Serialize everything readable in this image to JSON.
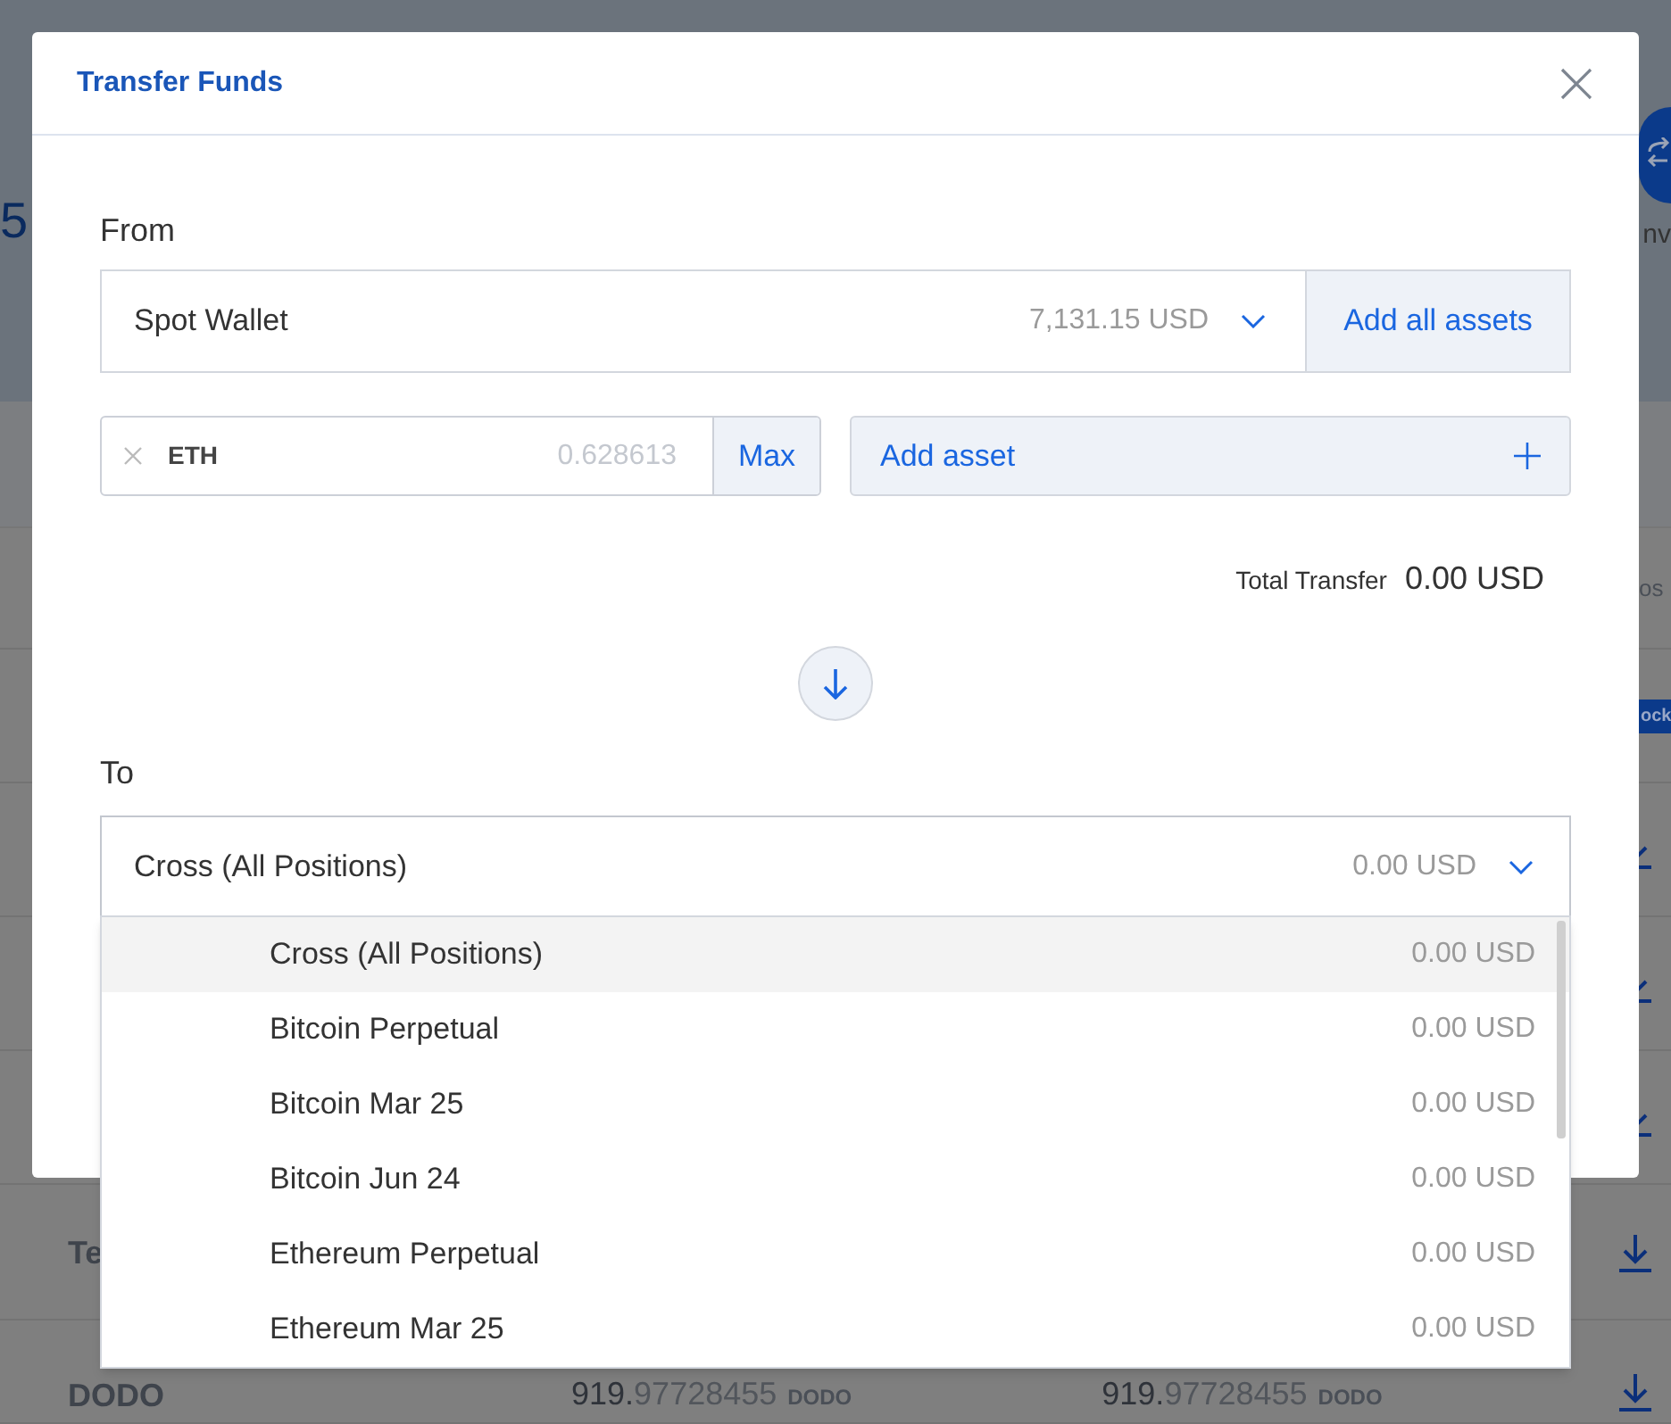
{
  "background": {
    "partial_value": "5",
    "action_label": "nv",
    "column_header": "os",
    "rows": [
      {
        "badge": "ock",
        "download": false
      },
      {
        "download": true
      },
      {
        "download": true
      },
      {
        "download": true
      },
      {
        "name": "Te",
        "download": true
      },
      {
        "name": "DODO",
        "download": true,
        "amounts": [
          {
            "whole": "919.",
            "fraction": "97728455",
            "unit": "DODO"
          },
          {
            "whole": "919.",
            "fraction": "97728455",
            "unit": "DODO"
          }
        ]
      }
    ]
  },
  "dialog": {
    "title": "Transfer Funds",
    "from": {
      "label": "From",
      "wallet": "Spot Wallet",
      "balance": "7,131.15 USD",
      "add_all_button": "Add all assets"
    },
    "assets": [
      {
        "symbol": "ETH",
        "placeholder": "0.628613",
        "max_button": "Max"
      }
    ],
    "add_asset_button": "Add asset",
    "total": {
      "label": "Total Transfer",
      "value": "0.00 USD"
    },
    "to": {
      "label": "To",
      "value": "Cross (All Positions)",
      "balance": "0.00 USD",
      "expanded": true,
      "options": [
        {
          "name": "Cross (All Positions)",
          "balance": "0.00 USD",
          "selected": true
        },
        {
          "name": "Bitcoin Perpetual",
          "balance": "0.00 USD",
          "selected": false
        },
        {
          "name": "Bitcoin Mar 25",
          "balance": "0.00 USD",
          "selected": false
        },
        {
          "name": "Bitcoin Jun 24",
          "balance": "0.00 USD",
          "selected": false
        },
        {
          "name": "Ethereum Perpetual",
          "balance": "0.00 USD",
          "selected": false
        },
        {
          "name": "Ethereum Mar 25",
          "balance": "0.00 USD",
          "selected": false
        }
      ]
    }
  }
}
